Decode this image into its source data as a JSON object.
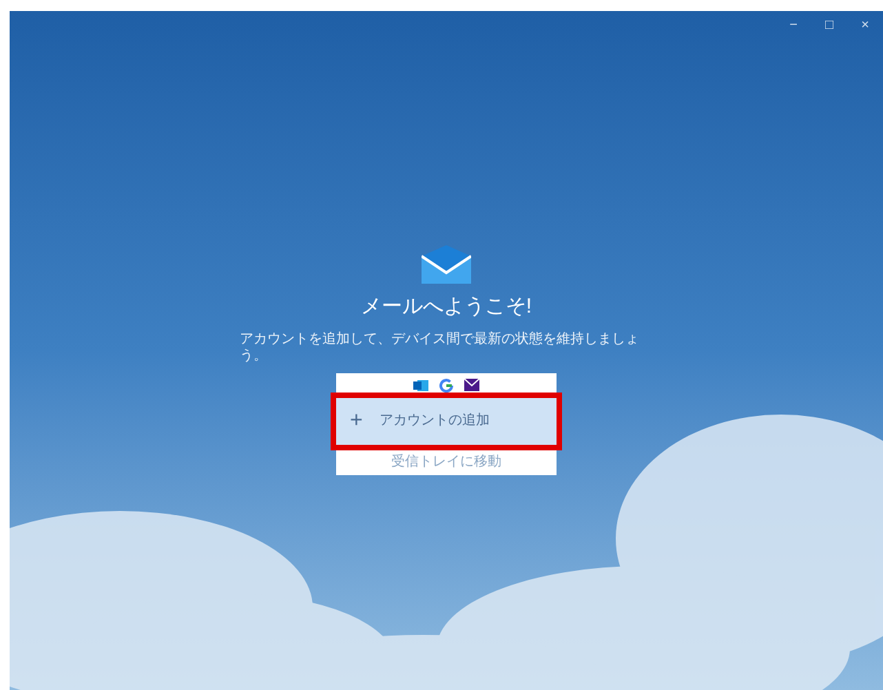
{
  "window": {
    "controls": [
      "−",
      "□",
      "×"
    ]
  },
  "welcome": {
    "title": "メールへようこそ!",
    "subtitle": "アカウントを追加して、デバイス間で最新の状態を維持しましょう。"
  },
  "card": {
    "add_account": {
      "icon": "+",
      "label": "アカウントの追加",
      "highlighted": true
    },
    "inbox_link": {
      "label": "受信トレイに移動",
      "disabled": true
    }
  }
}
